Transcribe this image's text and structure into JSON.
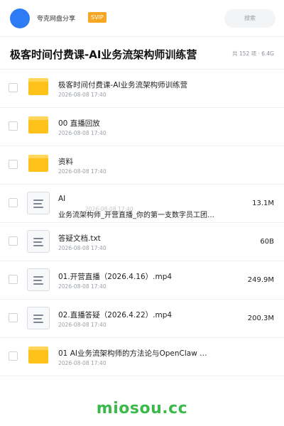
{
  "header": {
    "username": "夸克网盘分享",
    "badge": "SVIP",
    "search_placeholder": "搜索",
    "avatar_color": "#2f7bf6"
  },
  "folder": {
    "title": "极客时间付费课-AI业务流架构师训练营",
    "summary": "共 152 项 · 6.4G"
  },
  "files": [
    {
      "type": "folder",
      "name": "极客时间付费课-AI业务流架构师训练营",
      "date": "2026-08-08 17:40",
      "size": ""
    },
    {
      "type": "folder",
      "name": "00 直播回放",
      "date": "2026-08-08 17:40",
      "size": ""
    },
    {
      "type": "folder",
      "name": "资料",
      "date": "2026-08-08 17:40",
      "size": ""
    },
    {
      "type": "doc",
      "name": "AI",
      "name_line2": "业务流架构师_开营直播_你的第一支数字员工团…",
      "date": "2026-08-08 17:40",
      "size": "13.1M"
    },
    {
      "type": "doc",
      "name": "答疑文档.txt",
      "date": "2026-08-08 17:40",
      "size": "60B"
    },
    {
      "type": "doc",
      "name": "01.开营直播（2026.4.16）.mp4",
      "date": "2026-08-08 17:40",
      "size": "249.9M"
    },
    {
      "type": "doc",
      "name": "02.直播答疑（2026.4.22）.mp4",
      "date": "2026-08-08 17:40",
      "size": "200.3M"
    },
    {
      "type": "folder",
      "name": "01 AI业务流架构师的方法论与OpenClaw …",
      "date": "2026-08-08 17:40",
      "size": ""
    }
  ],
  "watermark": "miosou.cc",
  "colors": {
    "folder": "#ffc21a",
    "badge": "#f5a623",
    "watermark": "#3cb94a"
  }
}
